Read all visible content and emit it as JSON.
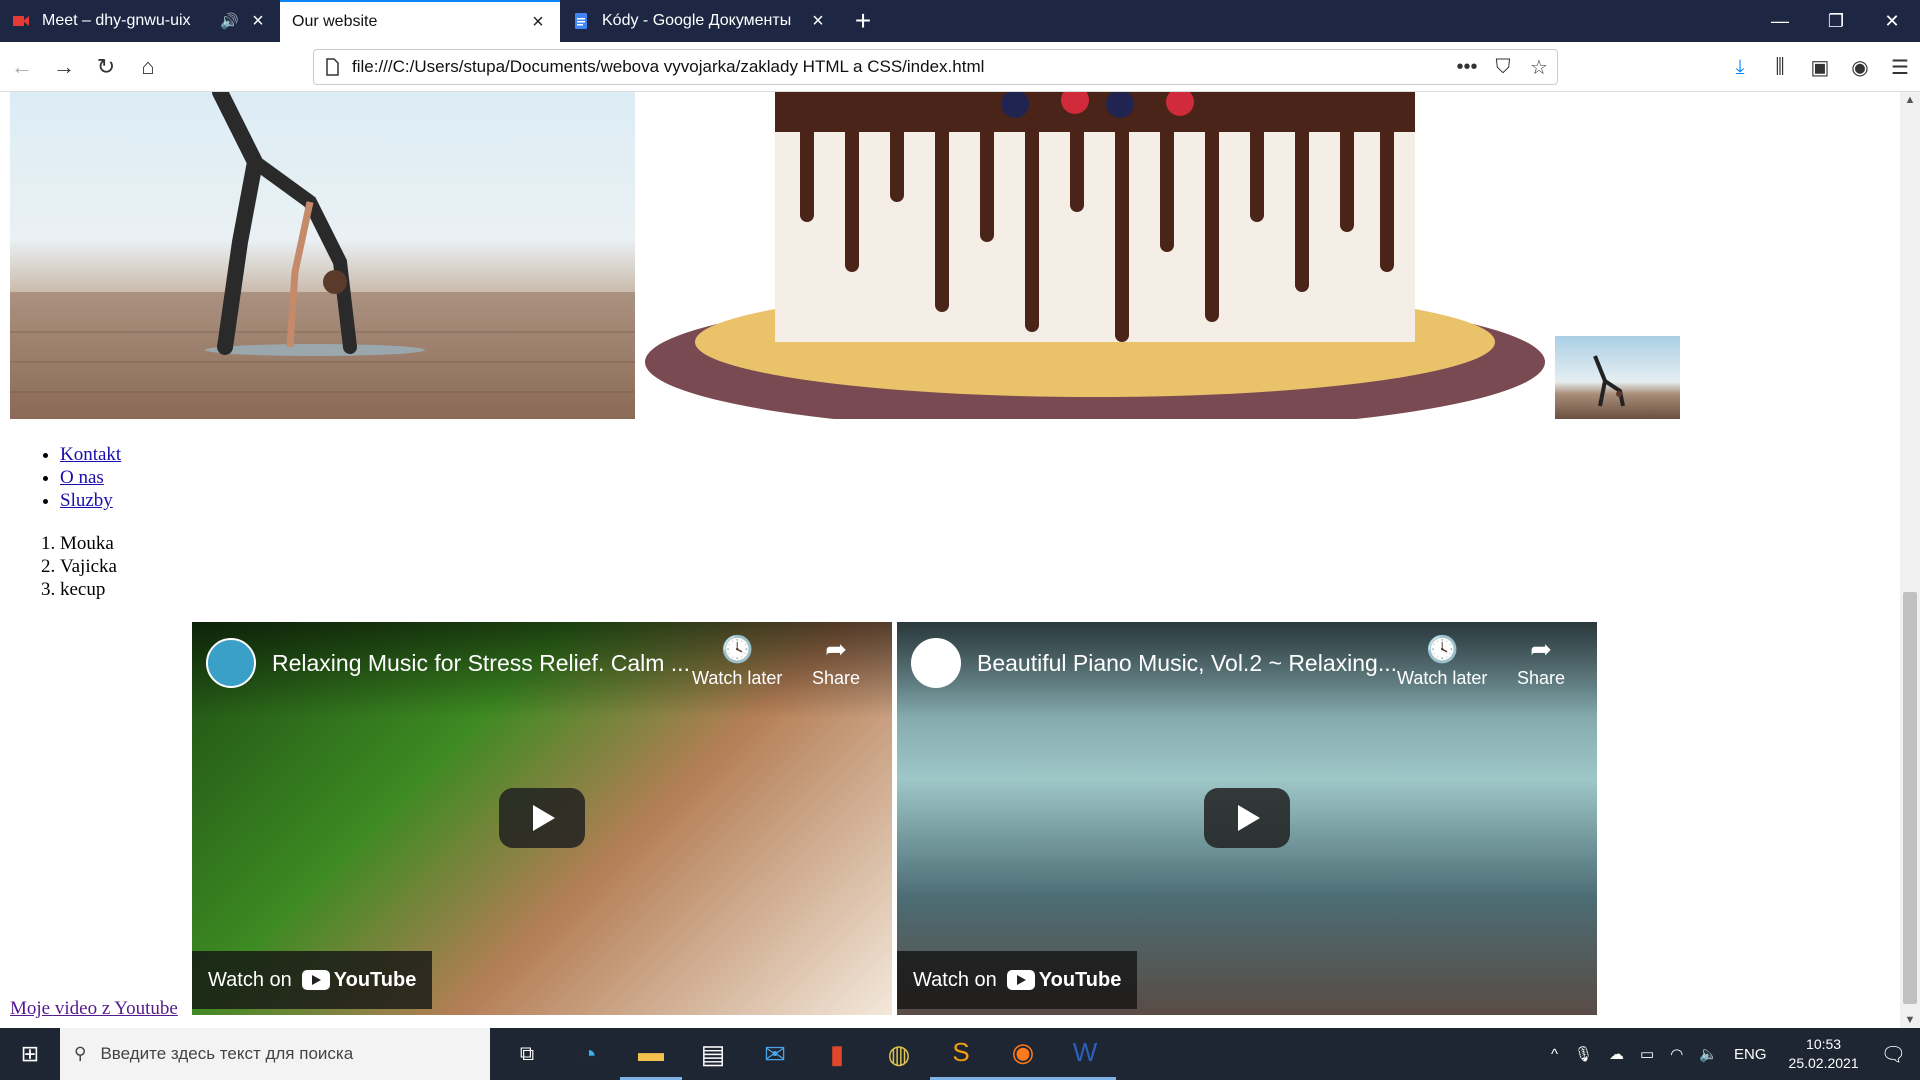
{
  "tabs": [
    {
      "title": "Meet – dhy-gnwu-uix",
      "icon": "meet-icon",
      "audio": true
    },
    {
      "title": "Our website",
      "icon": "",
      "active": true
    },
    {
      "title": "Kódy - Google Документы",
      "icon": "docs-icon"
    }
  ],
  "address": {
    "url": "file:///C:/Users/stupa/Documents/webova vyvojarka/zaklady HTML a CSS/index.html"
  },
  "page": {
    "nav_links": [
      "Kontakt",
      "O nas",
      "Sluzby"
    ],
    "ingredients": [
      "Mouka",
      "Vajicka",
      "kecup"
    ],
    "videos": [
      {
        "title": "Relaxing Music for Stress Relief. Calm ...",
        "watch_later": "Watch later",
        "share": "Share",
        "watch_on": "Watch on",
        "brand": "YouTube"
      },
      {
        "title": "Beautiful Piano Music, Vol.2 ~ Relaxing...",
        "watch_later": "Watch later",
        "share": "Share",
        "watch_on": "Watch on",
        "brand": "YouTube"
      }
    ],
    "youtube_link": "Moje video z Youtube"
  },
  "taskbar": {
    "search_placeholder": "Введите здесь текст для поиска",
    "language": "ENG",
    "time": "10:53",
    "date": "25.02.2021"
  },
  "colors": {
    "tabbar": "#1d2744",
    "accent": "#0a84ff",
    "link": "#1a0dab",
    "visited": "#551a8b"
  }
}
